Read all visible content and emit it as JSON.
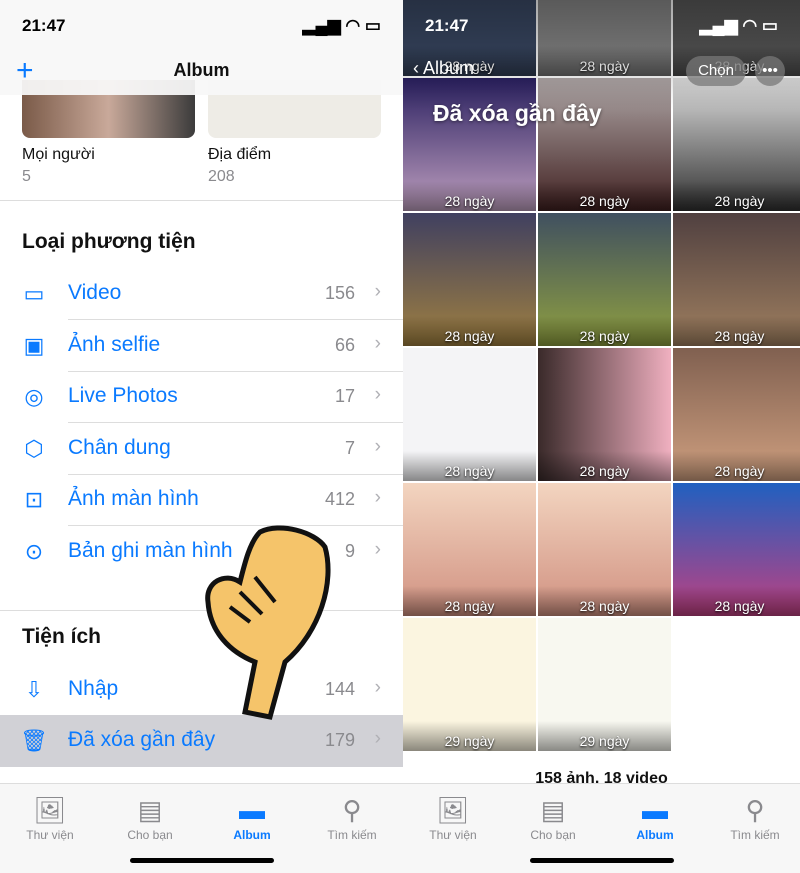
{
  "left": {
    "status": {
      "time": "21:47"
    },
    "header": {
      "title": "Album",
      "add_icon": "plus-icon"
    },
    "top_albums": [
      {
        "name": "Mọi người",
        "count": "5"
      },
      {
        "name": "Địa điểm",
        "count": "208"
      }
    ],
    "media_types": {
      "title": "Loại phương tiện",
      "items": [
        {
          "label": "Video",
          "count": "156",
          "icon": "video-icon"
        },
        {
          "label": "Ảnh selfie",
          "count": "66",
          "icon": "selfie-icon"
        },
        {
          "label": "Live Photos",
          "count": "17",
          "icon": "live-photos-icon"
        },
        {
          "label": "Chân dung",
          "count": "7",
          "icon": "cube-icon"
        },
        {
          "label": "Ảnh màn hình",
          "count": "412",
          "icon": "screenshot-icon"
        },
        {
          "label": "Bản ghi màn hình",
          "count": "9",
          "icon": "screen-record-icon"
        }
      ]
    },
    "utilities": {
      "title": "Tiện ích",
      "items": [
        {
          "label": "Nhập",
          "count": "144",
          "icon": "import-icon"
        },
        {
          "label": "Đã xóa gần đây",
          "count": "179",
          "icon": "trash-icon"
        }
      ]
    }
  },
  "right": {
    "status": {
      "time": "21:47"
    },
    "back_label": "Album",
    "title": "Đã xóa gần đây",
    "select_label": "Chọn",
    "more_icon": "ellipsis-icon",
    "cells": [
      "28 ngày",
      "28 ngày",
      "28 ngày",
      "28 ngày",
      "28 ngày",
      "28 ngày",
      "28 ngày",
      "28 ngày",
      "28 ngày",
      "28 ngày",
      "28 ngày",
      "28 ngày",
      "28 ngày",
      "28 ngày",
      "28 ngày",
      "29 ngày",
      "29 ngày"
    ],
    "summary": "158 ảnh, 18 video"
  },
  "tabs": [
    {
      "label": "Thư viện",
      "icon": "photos-icon"
    },
    {
      "label": "Cho bạn",
      "icon": "for-you-icon"
    },
    {
      "label": "Album",
      "icon": "album-icon",
      "active": true
    },
    {
      "label": "Tìm kiếm",
      "icon": "search-icon"
    }
  ],
  "colors": {
    "accent": "#0a7aff",
    "highlight": "#d1d1d6"
  }
}
